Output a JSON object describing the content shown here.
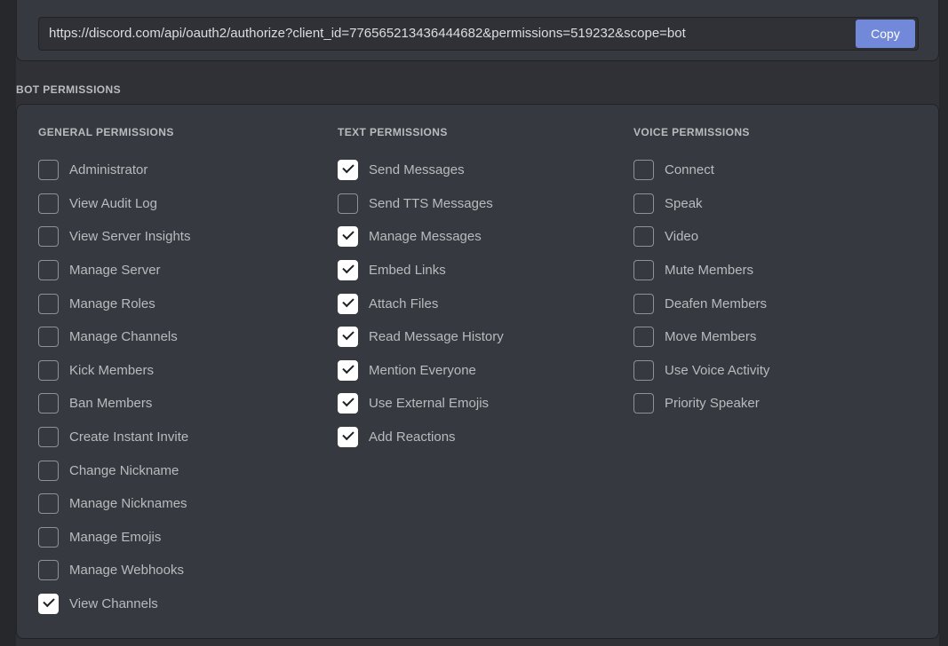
{
  "theme": {
    "page_bg": "#2f3136",
    "panel_bg": "#36393f",
    "input_bg": "#2f3136",
    "border": "#202225",
    "accent": "#7289da",
    "label_color": "#b9bbbe",
    "checkbox_on_bg": "#ffffff",
    "checkbox_off_border": "#8e9297"
  },
  "url_card": {
    "url_value": "https://discord.com/api/oauth2/authorize?client_id=776565213436444682&permissions=519232&scope=bot",
    "url_placeholder": "https://discord.com/api/oauth2/authorize",
    "copy_label": "Copy"
  },
  "section": {
    "label": "BOT PERMISSIONS"
  },
  "permissions": {
    "columns": [
      {
        "title": "GENERAL PERMISSIONS",
        "items": [
          {
            "label": "Administrator",
            "checked": false
          },
          {
            "label": "View Audit Log",
            "checked": false
          },
          {
            "label": "View Server Insights",
            "checked": false
          },
          {
            "label": "Manage Server",
            "checked": false
          },
          {
            "label": "Manage Roles",
            "checked": false
          },
          {
            "label": "Manage Channels",
            "checked": false
          },
          {
            "label": "Kick Members",
            "checked": false
          },
          {
            "label": "Ban Members",
            "checked": false
          },
          {
            "label": "Create Instant Invite",
            "checked": false
          },
          {
            "label": "Change Nickname",
            "checked": false
          },
          {
            "label": "Manage Nicknames",
            "checked": false
          },
          {
            "label": "Manage Emojis",
            "checked": false
          },
          {
            "label": "Manage Webhooks",
            "checked": false
          },
          {
            "label": "View Channels",
            "checked": true
          }
        ]
      },
      {
        "title": "TEXT PERMISSIONS",
        "items": [
          {
            "label": "Send Messages",
            "checked": true
          },
          {
            "label": "Send TTS Messages",
            "checked": false
          },
          {
            "label": "Manage Messages",
            "checked": true
          },
          {
            "label": "Embed Links",
            "checked": true
          },
          {
            "label": "Attach Files",
            "checked": true
          },
          {
            "label": "Read Message History",
            "checked": true
          },
          {
            "label": "Mention Everyone",
            "checked": true
          },
          {
            "label": "Use External Emojis",
            "checked": true
          },
          {
            "label": "Add Reactions",
            "checked": true
          }
        ]
      },
      {
        "title": "VOICE PERMISSIONS",
        "items": [
          {
            "label": "Connect",
            "checked": false
          },
          {
            "label": "Speak",
            "checked": false
          },
          {
            "label": "Video",
            "checked": false
          },
          {
            "label": "Mute Members",
            "checked": false
          },
          {
            "label": "Deafen Members",
            "checked": false
          },
          {
            "label": "Move Members",
            "checked": false
          },
          {
            "label": "Use Voice Activity",
            "checked": false
          },
          {
            "label": "Priority Speaker",
            "checked": false
          }
        ]
      }
    ]
  }
}
